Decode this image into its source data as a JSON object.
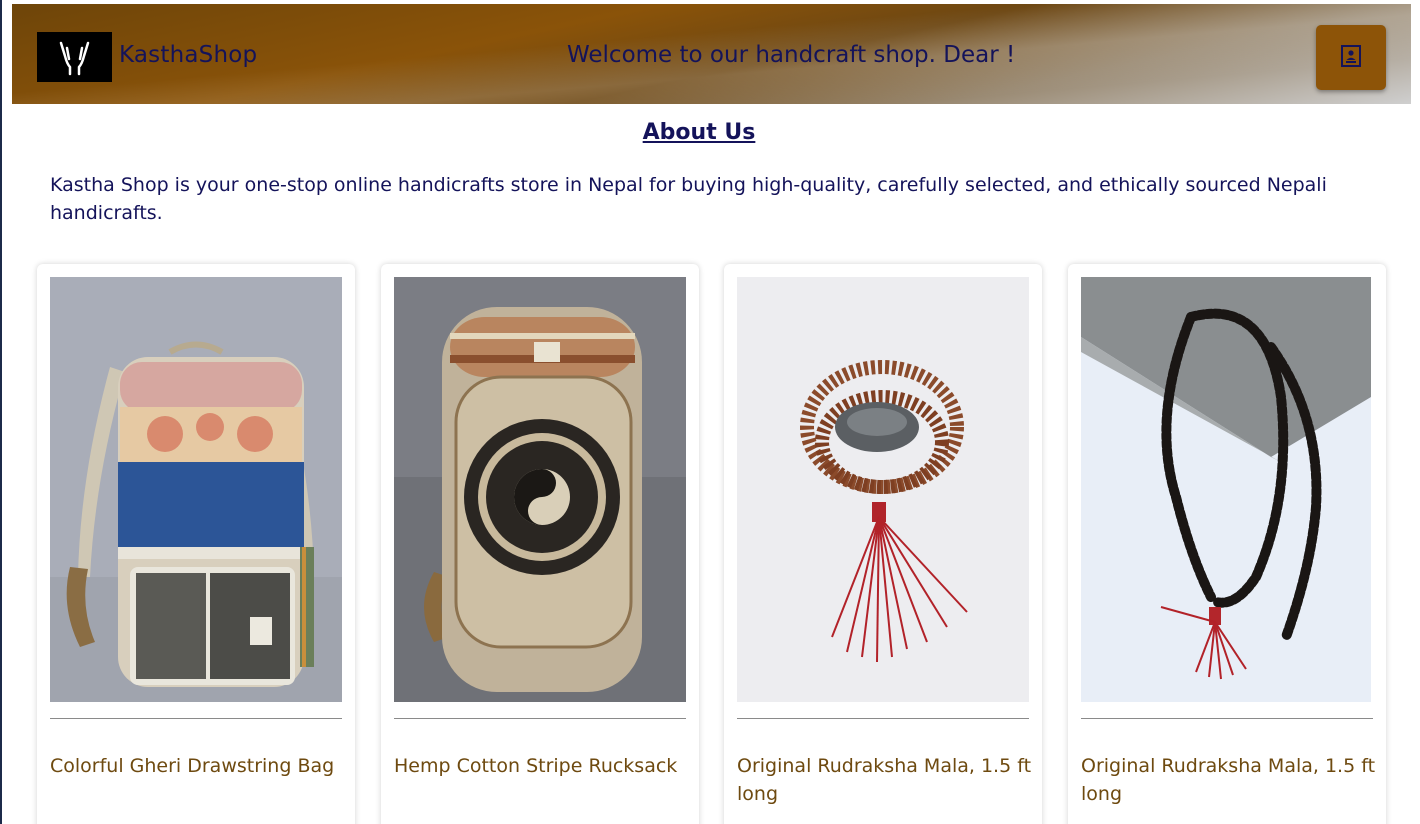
{
  "header": {
    "logo_icon": "hands-logo-icon",
    "brand": "KasthaShop",
    "welcome": "Welcome to our handcraft shop. Dear !",
    "menu_icon": "contact-card-icon"
  },
  "about": {
    "title": "About Us",
    "text": "Kastha Shop is your one-stop online handicrafts store in Nepal for buying high-quality, carefully selected, and ethically sourced Nepali handicrafts."
  },
  "products": [
    {
      "title": "Colorful Gheri Drawstring Bag",
      "image": "colorful-backpack-image"
    },
    {
      "title": "Hemp Cotton Stripe Rucksack",
      "image": "hemp-rucksack-image"
    },
    {
      "title": "Original Rudraksha Mala, 1.5 ft long",
      "image": "rudraksha-mala-image"
    },
    {
      "title": "Original Rudraksha Mala, 1.5 ft long",
      "image": "black-bead-mala-image"
    }
  ],
  "colors": {
    "header_brown": "#8a5309",
    "text_navy": "#14135a",
    "product_title": "#6e4a10",
    "menu_button": "#8d5408"
  }
}
